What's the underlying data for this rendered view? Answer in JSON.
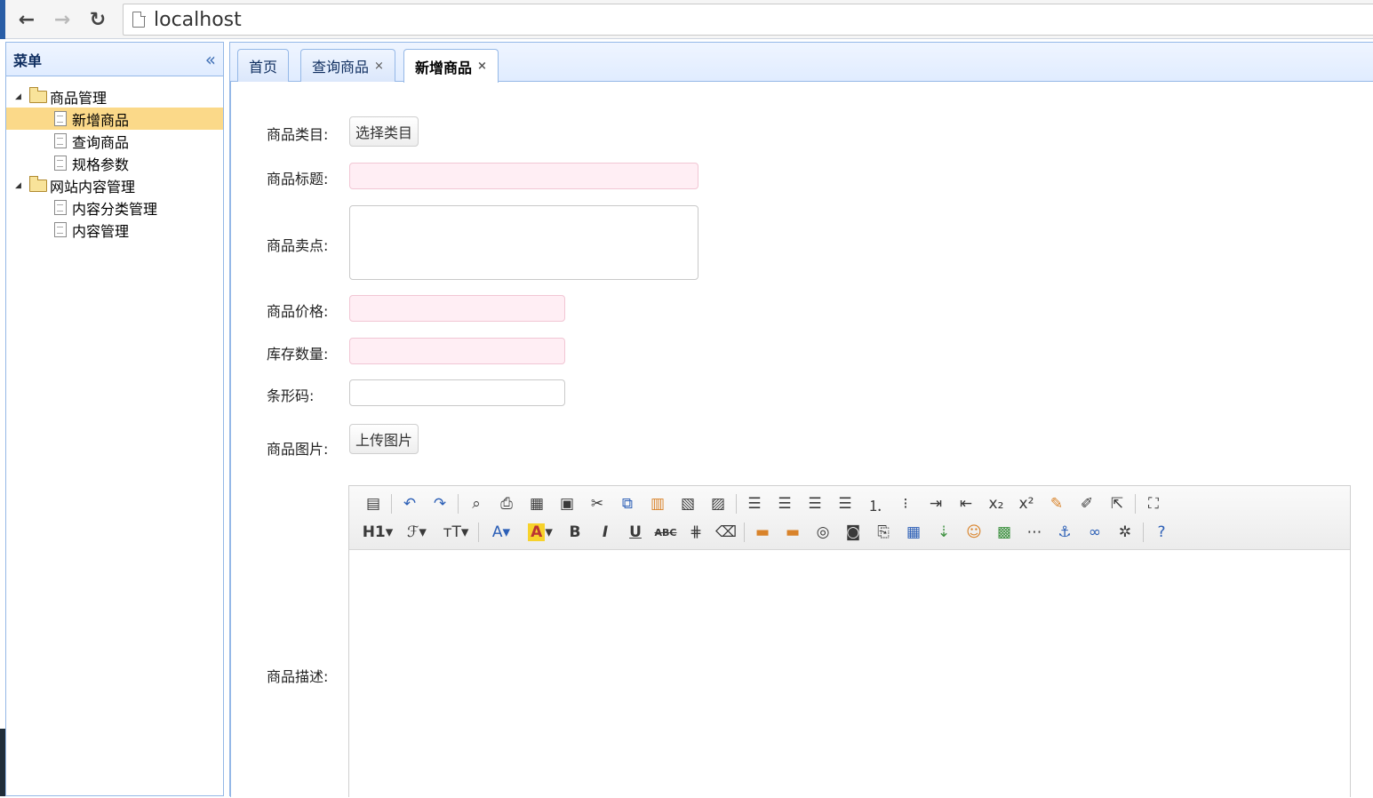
{
  "browser": {
    "back_icon": "←",
    "forward_icon": "→",
    "reload_icon": "↻",
    "url": "localhost"
  },
  "sidebar": {
    "title": "菜单",
    "collapse_icon": "«",
    "tree": [
      {
        "label": "商品管理",
        "type": "folder",
        "children": [
          {
            "label": "新增商品",
            "selected": true
          },
          {
            "label": "查询商品"
          },
          {
            "label": "规格参数"
          }
        ]
      },
      {
        "label": "网站内容管理",
        "type": "folder",
        "children": [
          {
            "label": "内容分类管理"
          },
          {
            "label": "内容管理"
          }
        ]
      }
    ]
  },
  "tabs": [
    {
      "label": "首页",
      "closable": false
    },
    {
      "label": "查询商品",
      "closable": true
    },
    {
      "label": "新增商品",
      "closable": true,
      "active": true
    }
  ],
  "tab_close_icon": "×",
  "form": {
    "category_label": "商品类目:",
    "category_button": "选择类目",
    "title_label": "商品标题:",
    "sellpoint_label": "商品卖点:",
    "price_label": "商品价格:",
    "stock_label": "库存数量:",
    "barcode_label": "条形码:",
    "image_label": "商品图片:",
    "upload_button": "上传图片",
    "desc_label": "商品描述:"
  },
  "editor": {
    "row2_labels": {
      "heading": "H1",
      "font": "ℱ",
      "size": "тT",
      "fore_color": "A",
      "back_color": "A",
      "bold": "B",
      "italic": "I",
      "underline": "U",
      "strike": "ABC"
    }
  },
  "colors": {
    "accent_border": "#95b8e7",
    "selected_bg": "#fbd989",
    "required_bg": "#ffeef4"
  }
}
